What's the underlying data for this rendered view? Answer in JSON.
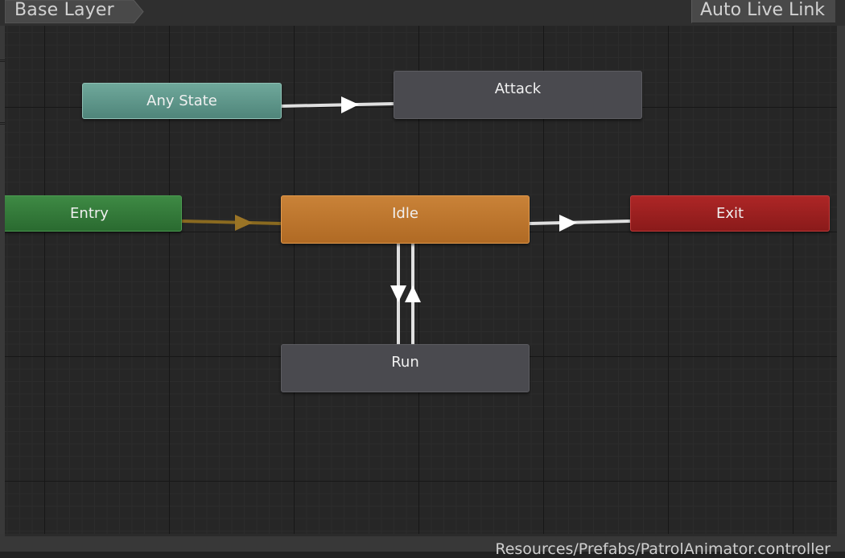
{
  "toolbar": {
    "layer_breadcrumb": "Base Layer",
    "live_link_button": "Auto Live Link"
  },
  "graph": {
    "states": {
      "any_state": "Any State",
      "attack": "Attack",
      "entry": "Entry",
      "idle": "Idle",
      "exit": "Exit",
      "run": "Run"
    },
    "transitions": [
      {
        "from": "Any State",
        "to": "Attack"
      },
      {
        "from": "Entry",
        "to": "Idle",
        "default": true
      },
      {
        "from": "Idle",
        "to": "Exit"
      },
      {
        "from": "Idle",
        "to": "Run"
      },
      {
        "from": "Run",
        "to": "Idle"
      }
    ]
  },
  "status_bar": {
    "asset_path": "Resources/Prefabs/PatrolAnimator.controller"
  },
  "colors": {
    "any_state": "#5f9a8e",
    "entry": "#35803b",
    "default_state": "#c07830",
    "exit": "#9c2020",
    "state": "#4a4a4f",
    "default_transition": "#8a6a20",
    "transition": "#e0e0e0"
  }
}
